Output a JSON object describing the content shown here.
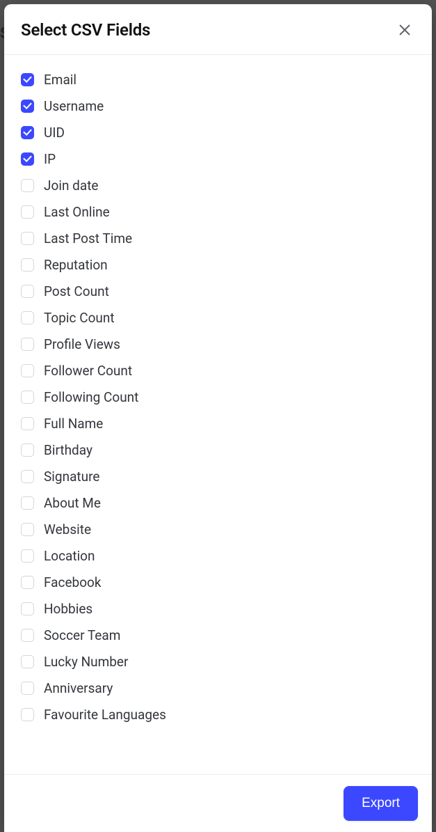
{
  "modal": {
    "title": "Select CSV Fields",
    "closeLabel": "Close"
  },
  "fields": [
    {
      "label": "Email",
      "checked": true
    },
    {
      "label": "Username",
      "checked": true
    },
    {
      "label": "UID",
      "checked": true
    },
    {
      "label": "IP",
      "checked": true
    },
    {
      "label": "Join date",
      "checked": false
    },
    {
      "label": "Last Online",
      "checked": false
    },
    {
      "label": "Last Post Time",
      "checked": false
    },
    {
      "label": "Reputation",
      "checked": false
    },
    {
      "label": "Post Count",
      "checked": false
    },
    {
      "label": "Topic Count",
      "checked": false
    },
    {
      "label": "Profile Views",
      "checked": false
    },
    {
      "label": "Follower Count",
      "checked": false
    },
    {
      "label": "Following Count",
      "checked": false
    },
    {
      "label": "Full Name",
      "checked": false
    },
    {
      "label": "Birthday",
      "checked": false
    },
    {
      "label": "Signature",
      "checked": false
    },
    {
      "label": "About Me",
      "checked": false
    },
    {
      "label": "Website",
      "checked": false
    },
    {
      "label": "Location",
      "checked": false
    },
    {
      "label": "Facebook",
      "checked": false
    },
    {
      "label": "Hobbies",
      "checked": false
    },
    {
      "label": "Soccer Team",
      "checked": false
    },
    {
      "label": "Lucky Number",
      "checked": false
    },
    {
      "label": "Anniversary",
      "checked": false
    },
    {
      "label": "Favourite Languages",
      "checked": false
    }
  ],
  "footer": {
    "exportLabel": "Export"
  }
}
